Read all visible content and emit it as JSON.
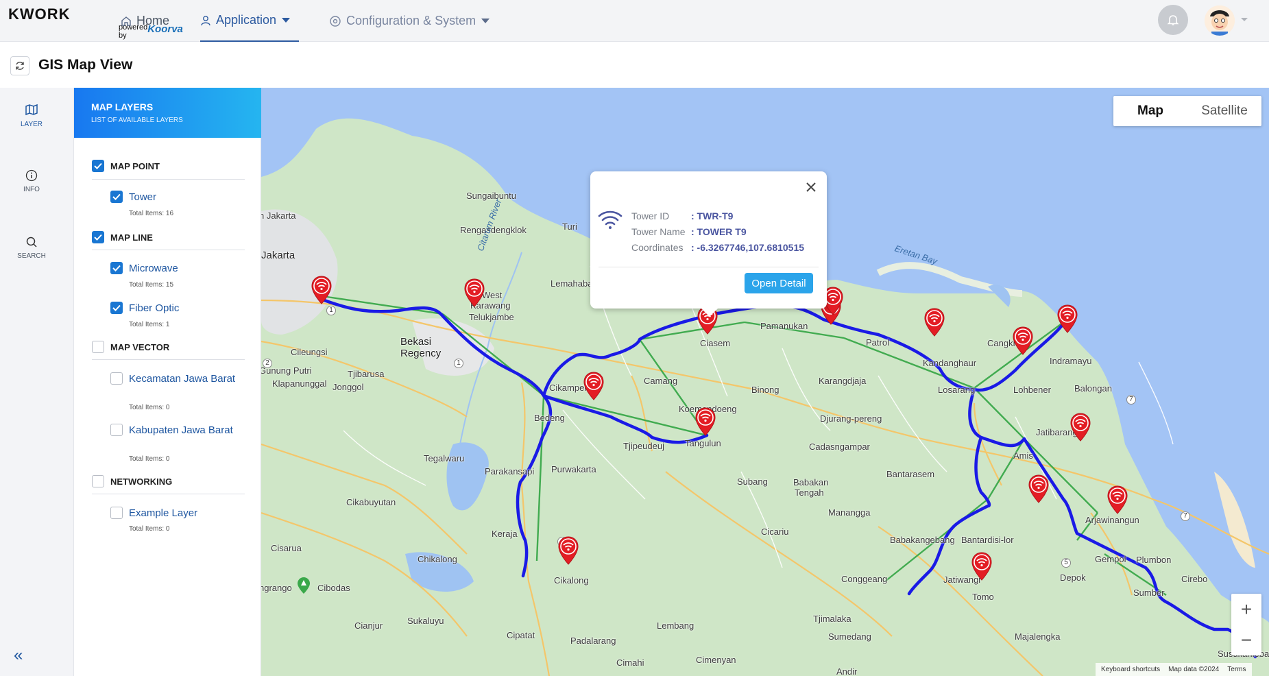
{
  "app": {
    "logo_main": "KWORK",
    "logo_powered": "powered by",
    "logo_brand": "Koorva"
  },
  "nav": {
    "home": "Home",
    "application": "Application",
    "configuration": "Configuration & System"
  },
  "page": {
    "title": "GIS Map View"
  },
  "rail": {
    "layer": "LAYER",
    "info": "INFO",
    "search": "SEARCH"
  },
  "layers": {
    "title": "MAP LAYERS",
    "subtitle": "LIST OF AVAILABLE LAYERS",
    "groups": [
      {
        "label": "MAP POINT",
        "checked": true,
        "items": [
          {
            "label": "Tower",
            "total": "Total Items: 16",
            "checked": true
          }
        ]
      },
      {
        "label": "MAP LINE",
        "checked": true,
        "items": [
          {
            "label": "Microwave",
            "total": "Total Items: 15",
            "checked": true
          },
          {
            "label": "Fiber Optic",
            "total": "Total Items: 1",
            "checked": true
          }
        ]
      },
      {
        "label": "MAP VECTOR",
        "checked": false,
        "items": [
          {
            "label": "Kecamatan Jawa Barat",
            "total": "Total Items: 0",
            "checked": false
          },
          {
            "label": "Kabupaten Jawa Barat",
            "total": "Total Items: 0",
            "checked": false
          }
        ]
      },
      {
        "label": "NETWORKING",
        "checked": false,
        "items": [
          {
            "label": "Example Layer",
            "total": "Total Items: 0",
            "checked": false
          }
        ]
      }
    ]
  },
  "map": {
    "type_map": "Map",
    "type_satellite": "Satellite",
    "zoom_in": "+",
    "zoom_out": "−",
    "attribution": [
      "Keyboard shortcuts",
      "Map data ©2024",
      "Terms"
    ],
    "labels": {
      "sungaibuntu": "Sungaibuntu",
      "jakarta1": "n Jakarta",
      "jakarta2": "Jakarta",
      "rengas": "Rengasdengklok",
      "turi": "Turi",
      "citarum": "Citarum River",
      "ciasem_bay": "Eretan Bay",
      "lemah": "Lemahabang",
      "westkar": "West",
      "karawang": "Karawang",
      "telukjambe": "Telukjambe",
      "bekasi1": "Bekasi",
      "bekasi2": "Regency",
      "cileungsi": "Cileungsi",
      "nunung": "Gunung Putri",
      "tjibarusa": "Tjibarusa",
      "klapa": "Klapanunggal",
      "jonggol": "Jonggol",
      "cikampek": "Cikampek",
      "cariang": "Camang",
      "ciasem": "Ciasem",
      "pamanukan": "Pamanukan",
      "patrol": "Patrol",
      "kandang": "Kandanghaur",
      "cangkring": "Cangkring",
      "indramayu": "Indramayu",
      "losarang": "Losarang",
      "lohbener": "Lohbener",
      "balongan": "Balongan",
      "karangdjaja": "Karangdjaja",
      "binong": "Binong",
      "koemendoeng": "Koemendoeng",
      "djurang": "Djurang-pereng",
      "bedeng": "Bedeng",
      "tjipeudeuj": "Tjipeudeuj",
      "tangulun": "Tangulun",
      "cadas": "Cadasngampar",
      "jatibarang": "Jatibarang",
      "amis": "Amis",
      "tegalwaru": "Tegalwaru",
      "parakan": "Parakansapi",
      "purwakarta": "Purwakarta",
      "subang": "Subang",
      "babakan1": "Babakan",
      "babakan2": "Tengah",
      "bantarasem": "Bantarasem",
      "cikabuyutan": "Cikabuyutan",
      "manangga": "Manangga",
      "arjawinangun": "Arjawinangun",
      "keraja": "Keraja",
      "cicariu": "Cicariu",
      "babakangebang": "Babakangebang",
      "bantardisi": "Bantardisi-lor",
      "cisarua": "Cisarua",
      "chikalong": "Chikalong",
      "cikalong": "Cikalong",
      "gempol": "Gempol",
      "plumbon": "Plumbon",
      "grango": "ngrango",
      "cibodas": "Cibodas",
      "conggeang": "Conggeang",
      "jatiwangi": "Jatiwangi",
      "depok": "Depok",
      "cirebon": "Cirebo",
      "tomo": "Tomo",
      "sumber": "Sumber",
      "tjimalaka": "Tjimalaka",
      "cianjur": "Cianjur",
      "sukaluyu": "Sukaluyu",
      "cipatat": "Cipatat",
      "lembang": "Lembang",
      "sumedang": "Sumedang",
      "majalengka": "Majalengka",
      "padalarang": "Padalarang",
      "cimahi": "Cimahi",
      "cimenyan": "Cimenyan",
      "andir": "Andir",
      "susukan": "Susukanlebak",
      "r1": "1",
      "r2": "2",
      "r4": "4",
      "r5": "5",
      "r7": "7",
      "r7b": "7",
      "r1b": "1"
    }
  },
  "popup": {
    "rows": [
      {
        "key": "Tower ID",
        "value": ": TWR-T9"
      },
      {
        "key": "Tower Name",
        "value": ": TOWER T9"
      },
      {
        "key": "Coordinates",
        "value": ": -6.3267746,107.6810515"
      }
    ],
    "button": "Open Detail"
  },
  "colors": {
    "accent": "#1976d2",
    "header_gradient_start": "#1878f0",
    "header_gradient_end": "#25b5f0",
    "fiber": "#1a1ae6",
    "microwave": "#3aa84a",
    "marker": "#e31d24",
    "water": "#a3c4f5",
    "land": "#cfe6c7"
  }
}
